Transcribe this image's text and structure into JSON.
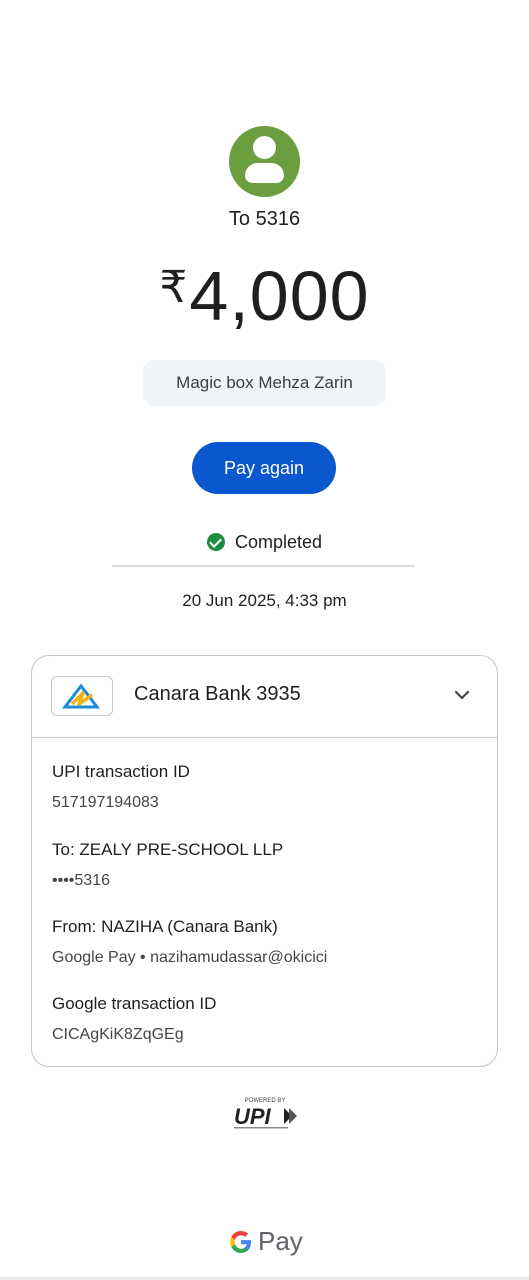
{
  "recipient": {
    "label": "To 5316",
    "avatar_icon": "person-icon",
    "avatar_color": "#6a9e3e"
  },
  "amount": {
    "currency": "₹",
    "value": "4,000"
  },
  "note": "Magic box Mehza Zarin",
  "pay_again_label": "Pay again",
  "status": {
    "label": "Completed",
    "icon": "check-circle-icon",
    "color": "#1e8e3e"
  },
  "datetime": "20 Jun 2025, 4:33 pm",
  "card": {
    "bank_name": "Canara Bank 3935",
    "bank_logo": "canara-bank-logo",
    "details": [
      {
        "label": "UPI transaction ID",
        "value": "517197194083"
      },
      {
        "label": "To: ZEALY PRE-SCHOOL LLP",
        "value": "••••5316"
      },
      {
        "label": "From: NAZIHA (Canara Bank)",
        "value": "Google Pay • nazihamudassar@okicici"
      },
      {
        "label": "Google transaction ID",
        "value": "CICAgKiK8ZqGEg"
      }
    ]
  },
  "footer": {
    "powered_by": "POWERED BY",
    "upi": "UPI",
    "brand_pay": "Pay"
  },
  "colors": {
    "accent": "#0b57d0",
    "note_bg": "#f1f4f9"
  }
}
